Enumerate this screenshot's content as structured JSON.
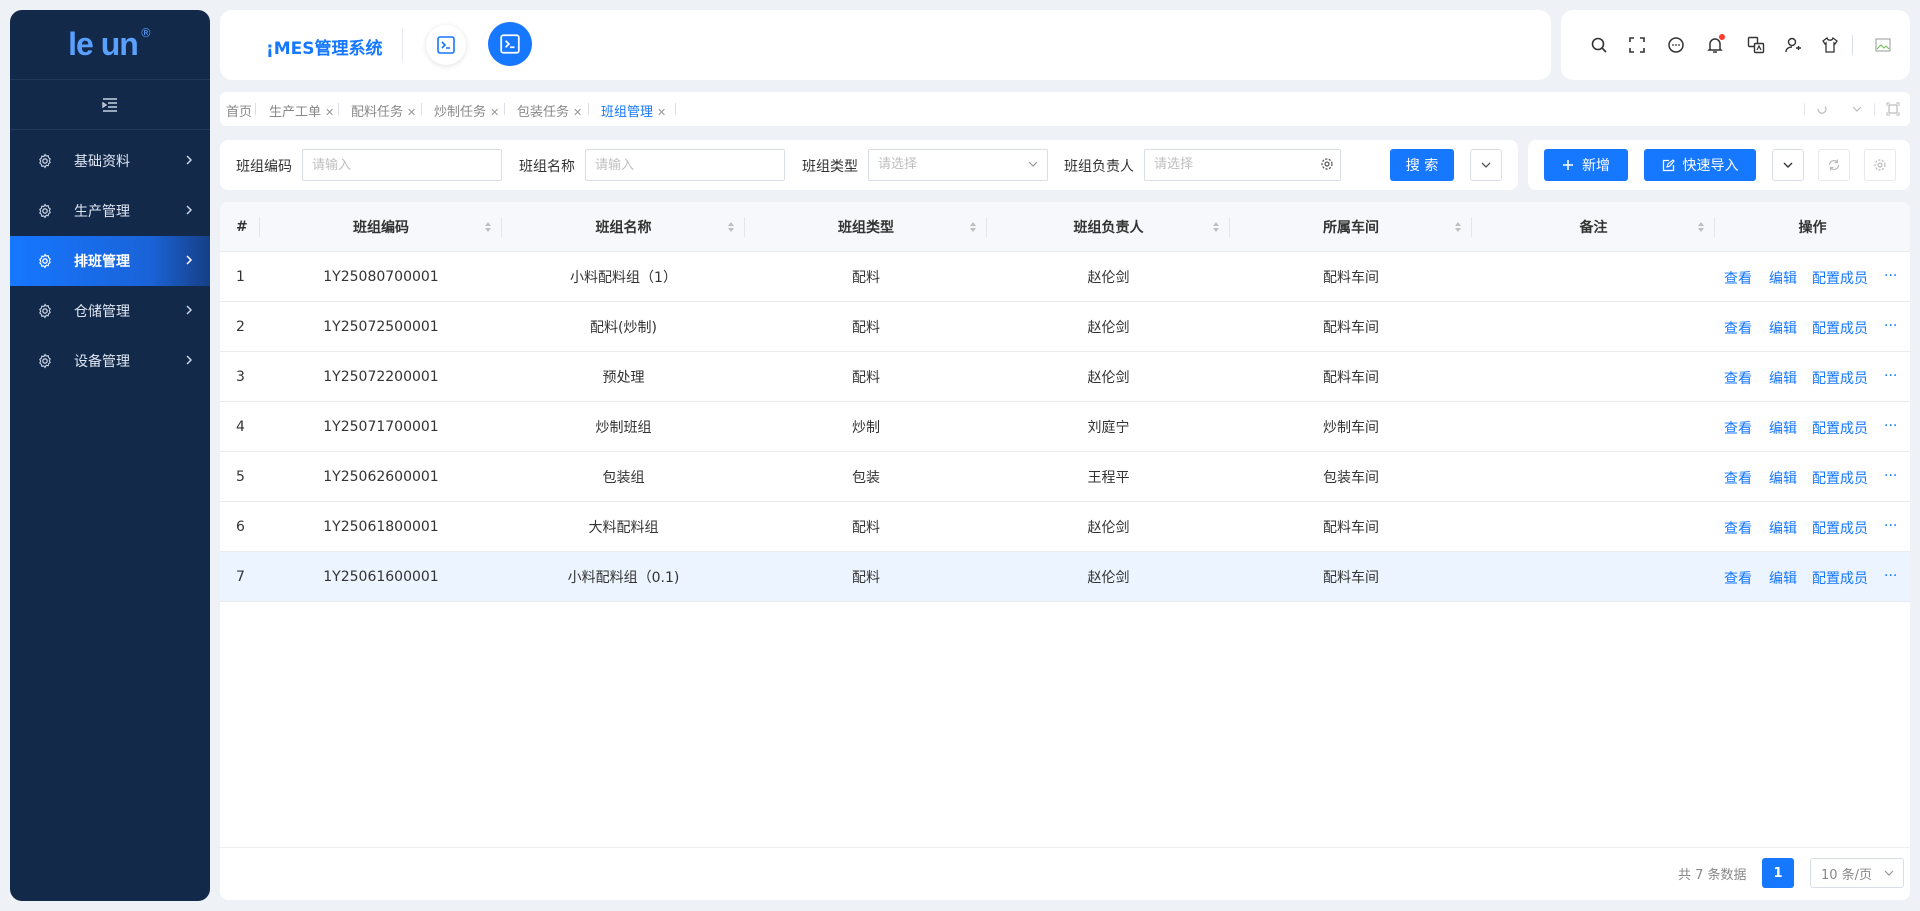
{
  "logo": {
    "text": "le  un",
    "mark": "®"
  },
  "sidebar": {
    "items": [
      {
        "label": "基础资料",
        "icon": "gear-icon",
        "active": false
      },
      {
        "label": "生产管理",
        "icon": "gear-icon",
        "active": false
      },
      {
        "label": "排班管理",
        "icon": "gear-icon",
        "active": true
      },
      {
        "label": "仓储管理",
        "icon": "gear-icon",
        "active": false
      },
      {
        "label": "设备管理",
        "icon": "gear-icon",
        "active": false
      }
    ]
  },
  "header": {
    "title": "¡MES管理系统",
    "right_icons": [
      "search-icon",
      "fullscreen-icon",
      "chat-icon",
      "bell-icon",
      "translate-icon",
      "user-icon",
      "shirt-icon",
      "avatar-image"
    ]
  },
  "tabs": [
    {
      "label": "首页",
      "closable": false
    },
    {
      "label": "生产工单",
      "closable": true
    },
    {
      "label": "配料任务",
      "closable": true
    },
    {
      "label": "炒制任务",
      "closable": true
    },
    {
      "label": "包装任务",
      "closable": true
    },
    {
      "label": "班组管理",
      "closable": true,
      "active": true
    }
  ],
  "filters": {
    "code_label": "班组编码",
    "code_placeholder": "请输入",
    "name_label": "班组名称",
    "name_placeholder": "请输入",
    "type_label": "班组类型",
    "type_placeholder": "请选择",
    "leader_label": "班组负责人",
    "leader_placeholder": "请选择",
    "search_label": "搜 索"
  },
  "actions": {
    "add_label": "新增",
    "import_label": "快速导入"
  },
  "table": {
    "columns": [
      "#",
      "班组编码",
      "班组名称",
      "班组类型",
      "班组负责人",
      "所属车间",
      "备注",
      "操作"
    ],
    "rows": [
      {
        "no": "1",
        "code": "1Y25080700001",
        "name": "小料配料组（1）",
        "type": "配料",
        "leader": "赵伦剑",
        "workshop": "配料车间",
        "remark": ""
      },
      {
        "no": "2",
        "code": "1Y25072500001",
        "name": "配料(炒制)",
        "type": "配料",
        "leader": "赵伦剑",
        "workshop": "配料车间",
        "remark": ""
      },
      {
        "no": "3",
        "code": "1Y25072200001",
        "name": "预处理",
        "type": "配料",
        "leader": "赵伦剑",
        "workshop": "配料车间",
        "remark": ""
      },
      {
        "no": "4",
        "code": "1Y25071700001",
        "name": "炒制班组",
        "type": "炒制",
        "leader": "刘庭宁",
        "workshop": "炒制车间",
        "remark": ""
      },
      {
        "no": "5",
        "code": "1Y25062600001",
        "name": "包装组",
        "type": "包装",
        "leader": "王程平",
        "workshop": "包装车间",
        "remark": ""
      },
      {
        "no": "6",
        "code": "1Y25061800001",
        "name": "大料配料组",
        "type": "配料",
        "leader": "赵伦剑",
        "workshop": "配料车间",
        "remark": ""
      },
      {
        "no": "7",
        "code": "1Y25061600001",
        "name": "小料配料组（0.1)",
        "type": "配料",
        "leader": "赵伦剑",
        "workshop": "配料车间",
        "remark": ""
      }
    ],
    "row_actions": {
      "view": "查看",
      "edit": "编辑",
      "members": "配置成员",
      "more": "···"
    }
  },
  "pagination": {
    "total_text": "共 7 条数据",
    "current_page": "1",
    "page_size": "10 条/页"
  },
  "colors": {
    "primary": "#1677ff",
    "sidebar_bg": "#13294a",
    "page_bg": "#eef1f6"
  }
}
